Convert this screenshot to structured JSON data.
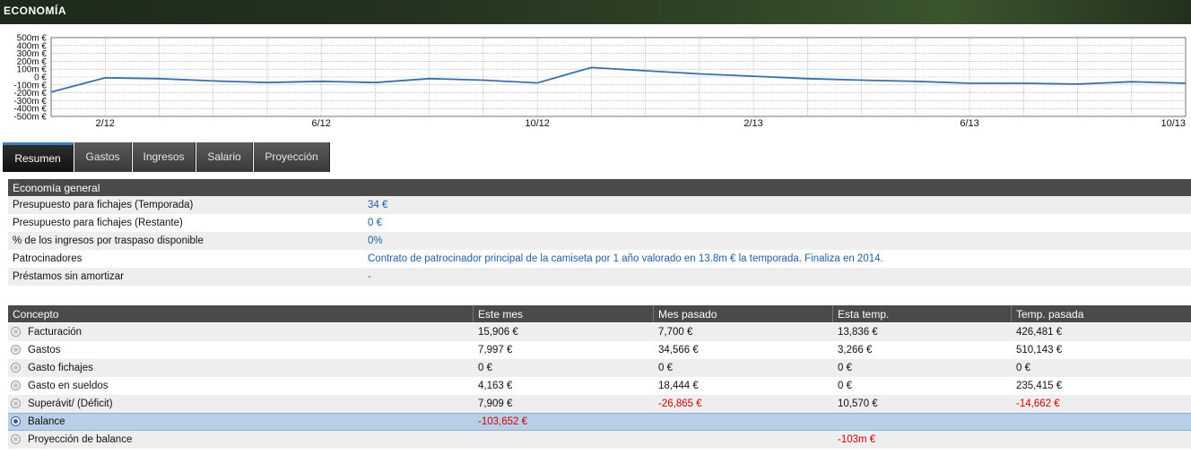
{
  "window": {
    "title": "ECONOMÍA"
  },
  "chart_data": {
    "type": "line",
    "y_ticks": [
      "500m €",
      "400m €",
      "300m €",
      "200m €",
      "100m €",
      "0 €",
      "-100m €",
      "-200m €",
      "-300m €",
      "-400m €",
      "-500m €"
    ],
    "ylim": [
      -500,
      500
    ],
    "x_ticks": [
      "2/12",
      "6/12",
      "10/12",
      "2/13",
      "6/13",
      "10/13"
    ],
    "grid": true,
    "line_color": "#3a6fa6",
    "x": [
      "1/12",
      "2/12",
      "3/12",
      "4/12",
      "5/12",
      "6/12",
      "7/12",
      "8/12",
      "9/12",
      "10/12",
      "11/12",
      "12/12",
      "1/13",
      "2/13",
      "3/13",
      "4/13",
      "5/13",
      "6/13",
      "7/13",
      "8/13",
      "9/13",
      "10/13"
    ],
    "values": [
      -190,
      -10,
      -20,
      -50,
      -70,
      -55,
      -70,
      -20,
      -40,
      -75,
      120,
      80,
      40,
      10,
      -20,
      -40,
      -55,
      -80,
      -80,
      -90,
      -60,
      -80
    ]
  },
  "tabs": [
    {
      "label": "Resumen",
      "active": true
    },
    {
      "label": "Gastos",
      "active": false
    },
    {
      "label": "Ingresos",
      "active": false
    },
    {
      "label": "Salario",
      "active": false
    },
    {
      "label": "Proyección",
      "active": false
    }
  ],
  "general": {
    "header": "Economía general",
    "rows": [
      {
        "label": "Presupuesto para fichajes (Temporada)",
        "value": "34 €"
      },
      {
        "label": "Presupuesto para fichajes (Restante)",
        "value": "0 €"
      },
      {
        "label": "% de los ingresos por traspaso disponible",
        "value": "0%"
      },
      {
        "label": "Patrocinadores",
        "value": "Contrato de patrocinador principal de la camiseta por 1 año valorado en 13.8m € la temporada. Finaliza en 2014."
      },
      {
        "label": "Préstamos sin amortizar",
        "value": "-"
      }
    ]
  },
  "table": {
    "columns": [
      "Concepto",
      "Este mes",
      "Mes pasado",
      "Esta temp.",
      "Temp. pasada"
    ],
    "rows": [
      {
        "concept": "Facturación",
        "este_mes": "15,906 €",
        "mes_pasado": "7,700 €",
        "esta_temp": "13,836 €",
        "temp_pasada": "426,481 €"
      },
      {
        "concept": "Gastos",
        "este_mes": "7,997 €",
        "mes_pasado": "34,566 €",
        "esta_temp": "3,266 €",
        "temp_pasada": "510,143 €"
      },
      {
        "concept": "Gasto fichajes",
        "este_mes": "0 €",
        "mes_pasado": "0 €",
        "esta_temp": "0 €",
        "temp_pasada": "0 €"
      },
      {
        "concept": "Gasto en sueldos",
        "este_mes": "4,163 €",
        "mes_pasado": "18,444 €",
        "esta_temp": "0 €",
        "temp_pasada": "235,415 €"
      },
      {
        "concept": "Superávit/ (Déficit)",
        "este_mes": "7,909 €",
        "mes_pasado": "-26,865 €",
        "esta_temp": "10,570 €",
        "temp_pasada": "-14,662 €"
      },
      {
        "concept": "Balance",
        "este_mes": "-103,652 €",
        "mes_pasado": "",
        "esta_temp": "",
        "temp_pasada": ""
      },
      {
        "concept": "Proyección de balance",
        "este_mes": "",
        "mes_pasado": "",
        "esta_temp": "-103m €",
        "temp_pasada": ""
      }
    ]
  },
  "colors": {
    "negative": "#d10000",
    "value_blue": "#1f5fa8",
    "selected_row": "#b9cfe8"
  }
}
